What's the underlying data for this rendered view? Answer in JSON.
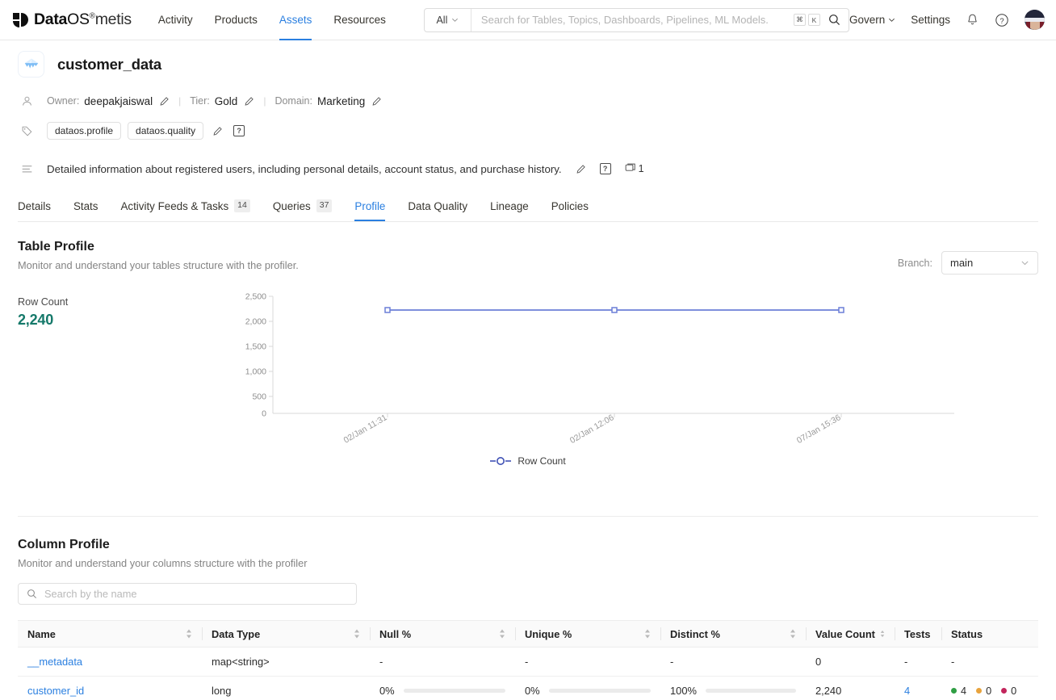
{
  "topnav": {
    "brand": {
      "part1": "Data",
      "part2": "OS",
      "reg": "®",
      "part3": "metis"
    },
    "links": [
      {
        "label": "Activity",
        "active": false
      },
      {
        "label": "Products",
        "active": false
      },
      {
        "label": "Assets",
        "active": true
      },
      {
        "label": "Resources",
        "active": false
      }
    ],
    "search": {
      "scope": "All",
      "placeholder": "Search for Tables, Topics, Dashboards, Pipelines, ML Models.",
      "value": "",
      "kbd_cmd": "⌘",
      "kbd_key": "K"
    },
    "right": {
      "govern": "Govern",
      "settings": "Settings",
      "bell_icon": "bell-icon",
      "help_icon": "help-circle-icon",
      "avatar_icon": "user-avatar"
    }
  },
  "asset": {
    "icon_name": "iceberg-table-icon",
    "title": "customer_data",
    "owner_label": "Owner:",
    "owner_value": "deepakjaiswal",
    "tier_label": "Tier:",
    "tier_value": "Gold",
    "domain_label": "Domain:",
    "domain_value": "Marketing",
    "tags": [
      "dataos.profile",
      "dataos.quality"
    ],
    "tag_help": "?",
    "description": "Detailed information about registered users, including personal details, account status, and purchase history.",
    "description_help": "?",
    "comment_count": "1"
  },
  "tabs": [
    {
      "label": "Details",
      "badge": null,
      "active": false
    },
    {
      "label": "Stats",
      "badge": null,
      "active": false
    },
    {
      "label": "Activity Feeds & Tasks",
      "badge": "14",
      "active": false
    },
    {
      "label": "Queries",
      "badge": "37",
      "active": false
    },
    {
      "label": "Profile",
      "badge": null,
      "active": true
    },
    {
      "label": "Data Quality",
      "badge": null,
      "active": false
    },
    {
      "label": "Lineage",
      "badge": null,
      "active": false
    },
    {
      "label": "Policies",
      "badge": null,
      "active": false
    }
  ],
  "table_profile": {
    "title": "Table Profile",
    "subtitle": "Monitor and understand your tables structure with the profiler.",
    "branch_label": "Branch:",
    "branch_value": "main",
    "row_count_label": "Row Count",
    "row_count_value": "2,240",
    "row_count_color": "#15796a"
  },
  "chart_data": {
    "type": "line",
    "title": "",
    "x": [
      "02/Jan 11:31",
      "02/Jan 12:06",
      "07/Jan 15:36"
    ],
    "series": [
      {
        "name": "Row Count",
        "values": [
          2240,
          2240,
          2240
        ],
        "color": "#6b7fd7"
      }
    ],
    "yticks": [
      0,
      500,
      1000,
      1500,
      2000,
      2500
    ],
    "ytick_labels": [
      "0",
      "500",
      "1,000",
      "1,500",
      "2,000",
      "2,500"
    ],
    "ylim": [
      0,
      2500
    ],
    "xlabel": "",
    "ylabel": "",
    "grid": false,
    "legend": [
      "Row Count"
    ],
    "legend_position": "bottom"
  },
  "column_profile": {
    "title": "Column Profile",
    "subtitle": "Monitor and understand your columns structure with the profiler",
    "search_placeholder": "Search by the name",
    "search_value": "",
    "headers": [
      {
        "label": "Name",
        "sortable": true
      },
      {
        "label": "Data Type",
        "sortable": true
      },
      {
        "label": "Null %",
        "sortable": true
      },
      {
        "label": "Unique %",
        "sortable": true
      },
      {
        "label": "Distinct %",
        "sortable": true
      },
      {
        "label": "Value Count",
        "sortable": true
      },
      {
        "label": "Tests",
        "sortable": true
      },
      {
        "label": "Status",
        "sortable": false
      }
    ],
    "rows": [
      {
        "name": "__metadata",
        "data_type": "map<string>",
        "null_pct": "-",
        "null_bar": null,
        "unique_pct": "-",
        "unique_bar": null,
        "distinct_pct": "-",
        "distinct_bar": null,
        "value_count": "0",
        "tests": "-",
        "status": null,
        "status_text": "-"
      },
      {
        "name": "customer_id",
        "data_type": "long",
        "null_pct": "0%",
        "null_bar": 0,
        "unique_pct": "0%",
        "unique_bar": 0,
        "distinct_pct": "100%",
        "distinct_bar": 100,
        "value_count": "2,240",
        "tests": "4",
        "status": [
          {
            "count": "4",
            "color": "#2f9e44"
          },
          {
            "count": "0",
            "color": "#e8a33d"
          },
          {
            "count": "0",
            "color": "#c2255c"
          }
        ],
        "status_text": null
      }
    ]
  }
}
